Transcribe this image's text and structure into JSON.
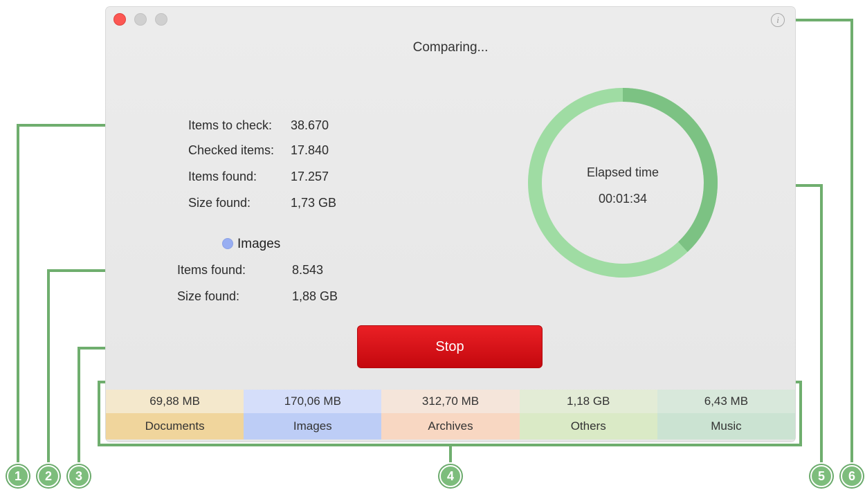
{
  "window": {
    "status_title": "Comparing...",
    "info_icon_glyph": "i"
  },
  "overall": {
    "items_to_check_label": "Items to check:",
    "items_to_check_value": "38.670",
    "checked_items_label": "Checked items:",
    "checked_items_value": "17.840",
    "items_found_label": "Items found:",
    "items_found_value": "17.257",
    "size_found_label": "Size found:",
    "size_found_value": "1,73 GB"
  },
  "category": {
    "name": "Images",
    "dot_color": "#98aef2",
    "items_found_label": "Items found:",
    "items_found_value": "8.543",
    "size_found_label": "Size found:",
    "size_found_value": "1,88 GB"
  },
  "stop_button": {
    "label": "Stop"
  },
  "timer": {
    "label": "Elapsed time",
    "value": "00:01:34",
    "progress_fraction": 0.38,
    "track_color": "#9fdca3",
    "progress_color": "#7cc283"
  },
  "summary": {
    "items": [
      {
        "size": "69,88 MB",
        "name": "Documents",
        "size_bg": "#f4e8cc",
        "name_bg": "#f0d59c"
      },
      {
        "size": "170,06 MB",
        "name": "Images",
        "size_bg": "#d5defa",
        "name_bg": "#bdcdf6"
      },
      {
        "size": "312,70 MB",
        "name": "Archives",
        "size_bg": "#f5e5da",
        "name_bg": "#f8d7c2"
      },
      {
        "size": "1,18 GB",
        "name": "Others",
        "size_bg": "#e3ecd6",
        "name_bg": "#daeac6"
      },
      {
        "size": "6,43 MB",
        "name": "Music",
        "size_bg": "#d8e8db",
        "name_bg": "#cbe3d2"
      }
    ]
  },
  "callouts": {
    "color": "#6fae6e",
    "markers": [
      "1",
      "2",
      "3",
      "4",
      "5",
      "6"
    ]
  }
}
